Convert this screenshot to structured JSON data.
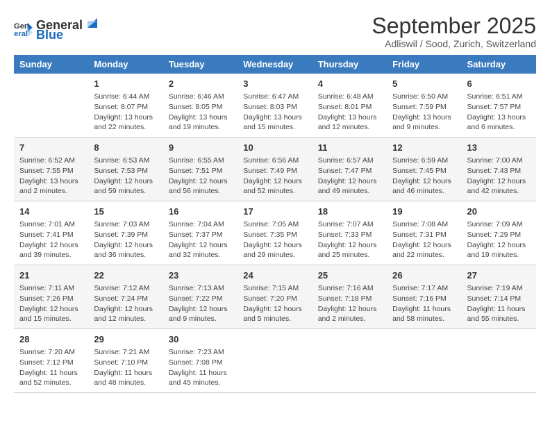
{
  "logo": {
    "general": "General",
    "blue": "Blue"
  },
  "title": "September 2025",
  "subtitle": "Adliswil / Sood, Zurich, Switzerland",
  "days": [
    "Sunday",
    "Monday",
    "Tuesday",
    "Wednesday",
    "Thursday",
    "Friday",
    "Saturday"
  ],
  "weeks": [
    [
      {
        "num": "",
        "lines": []
      },
      {
        "num": "1",
        "lines": [
          "Sunrise: 6:44 AM",
          "Sunset: 8:07 PM",
          "Daylight: 13 hours",
          "and 22 minutes."
        ]
      },
      {
        "num": "2",
        "lines": [
          "Sunrise: 6:46 AM",
          "Sunset: 8:05 PM",
          "Daylight: 13 hours",
          "and 19 minutes."
        ]
      },
      {
        "num": "3",
        "lines": [
          "Sunrise: 6:47 AM",
          "Sunset: 8:03 PM",
          "Daylight: 13 hours",
          "and 15 minutes."
        ]
      },
      {
        "num": "4",
        "lines": [
          "Sunrise: 6:48 AM",
          "Sunset: 8:01 PM",
          "Daylight: 13 hours",
          "and 12 minutes."
        ]
      },
      {
        "num": "5",
        "lines": [
          "Sunrise: 6:50 AM",
          "Sunset: 7:59 PM",
          "Daylight: 13 hours",
          "and 9 minutes."
        ]
      },
      {
        "num": "6",
        "lines": [
          "Sunrise: 6:51 AM",
          "Sunset: 7:57 PM",
          "Daylight: 13 hours",
          "and 6 minutes."
        ]
      }
    ],
    [
      {
        "num": "7",
        "lines": [
          "Sunrise: 6:52 AM",
          "Sunset: 7:55 PM",
          "Daylight: 13 hours",
          "and 2 minutes."
        ]
      },
      {
        "num": "8",
        "lines": [
          "Sunrise: 6:53 AM",
          "Sunset: 7:53 PM",
          "Daylight: 12 hours",
          "and 59 minutes."
        ]
      },
      {
        "num": "9",
        "lines": [
          "Sunrise: 6:55 AM",
          "Sunset: 7:51 PM",
          "Daylight: 12 hours",
          "and 56 minutes."
        ]
      },
      {
        "num": "10",
        "lines": [
          "Sunrise: 6:56 AM",
          "Sunset: 7:49 PM",
          "Daylight: 12 hours",
          "and 52 minutes."
        ]
      },
      {
        "num": "11",
        "lines": [
          "Sunrise: 6:57 AM",
          "Sunset: 7:47 PM",
          "Daylight: 12 hours",
          "and 49 minutes."
        ]
      },
      {
        "num": "12",
        "lines": [
          "Sunrise: 6:59 AM",
          "Sunset: 7:45 PM",
          "Daylight: 12 hours",
          "and 46 minutes."
        ]
      },
      {
        "num": "13",
        "lines": [
          "Sunrise: 7:00 AM",
          "Sunset: 7:43 PM",
          "Daylight: 12 hours",
          "and 42 minutes."
        ]
      }
    ],
    [
      {
        "num": "14",
        "lines": [
          "Sunrise: 7:01 AM",
          "Sunset: 7:41 PM",
          "Daylight: 12 hours",
          "and 39 minutes."
        ]
      },
      {
        "num": "15",
        "lines": [
          "Sunrise: 7:03 AM",
          "Sunset: 7:39 PM",
          "Daylight: 12 hours",
          "and 36 minutes."
        ]
      },
      {
        "num": "16",
        "lines": [
          "Sunrise: 7:04 AM",
          "Sunset: 7:37 PM",
          "Daylight: 12 hours",
          "and 32 minutes."
        ]
      },
      {
        "num": "17",
        "lines": [
          "Sunrise: 7:05 AM",
          "Sunset: 7:35 PM",
          "Daylight: 12 hours",
          "and 29 minutes."
        ]
      },
      {
        "num": "18",
        "lines": [
          "Sunrise: 7:07 AM",
          "Sunset: 7:33 PM",
          "Daylight: 12 hours",
          "and 25 minutes."
        ]
      },
      {
        "num": "19",
        "lines": [
          "Sunrise: 7:08 AM",
          "Sunset: 7:31 PM",
          "Daylight: 12 hours",
          "and 22 minutes."
        ]
      },
      {
        "num": "20",
        "lines": [
          "Sunrise: 7:09 AM",
          "Sunset: 7:29 PM",
          "Daylight: 12 hours",
          "and 19 minutes."
        ]
      }
    ],
    [
      {
        "num": "21",
        "lines": [
          "Sunrise: 7:11 AM",
          "Sunset: 7:26 PM",
          "Daylight: 12 hours",
          "and 15 minutes."
        ]
      },
      {
        "num": "22",
        "lines": [
          "Sunrise: 7:12 AM",
          "Sunset: 7:24 PM",
          "Daylight: 12 hours",
          "and 12 minutes."
        ]
      },
      {
        "num": "23",
        "lines": [
          "Sunrise: 7:13 AM",
          "Sunset: 7:22 PM",
          "Daylight: 12 hours",
          "and 9 minutes."
        ]
      },
      {
        "num": "24",
        "lines": [
          "Sunrise: 7:15 AM",
          "Sunset: 7:20 PM",
          "Daylight: 12 hours",
          "and 5 minutes."
        ]
      },
      {
        "num": "25",
        "lines": [
          "Sunrise: 7:16 AM",
          "Sunset: 7:18 PM",
          "Daylight: 12 hours",
          "and 2 minutes."
        ]
      },
      {
        "num": "26",
        "lines": [
          "Sunrise: 7:17 AM",
          "Sunset: 7:16 PM",
          "Daylight: 11 hours",
          "and 58 minutes."
        ]
      },
      {
        "num": "27",
        "lines": [
          "Sunrise: 7:19 AM",
          "Sunset: 7:14 PM",
          "Daylight: 11 hours",
          "and 55 minutes."
        ]
      }
    ],
    [
      {
        "num": "28",
        "lines": [
          "Sunrise: 7:20 AM",
          "Sunset: 7:12 PM",
          "Daylight: 11 hours",
          "and 52 minutes."
        ]
      },
      {
        "num": "29",
        "lines": [
          "Sunrise: 7:21 AM",
          "Sunset: 7:10 PM",
          "Daylight: 11 hours",
          "and 48 minutes."
        ]
      },
      {
        "num": "30",
        "lines": [
          "Sunrise: 7:23 AM",
          "Sunset: 7:08 PM",
          "Daylight: 11 hours",
          "and 45 minutes."
        ]
      },
      {
        "num": "",
        "lines": []
      },
      {
        "num": "",
        "lines": []
      },
      {
        "num": "",
        "lines": []
      },
      {
        "num": "",
        "lines": []
      }
    ]
  ]
}
